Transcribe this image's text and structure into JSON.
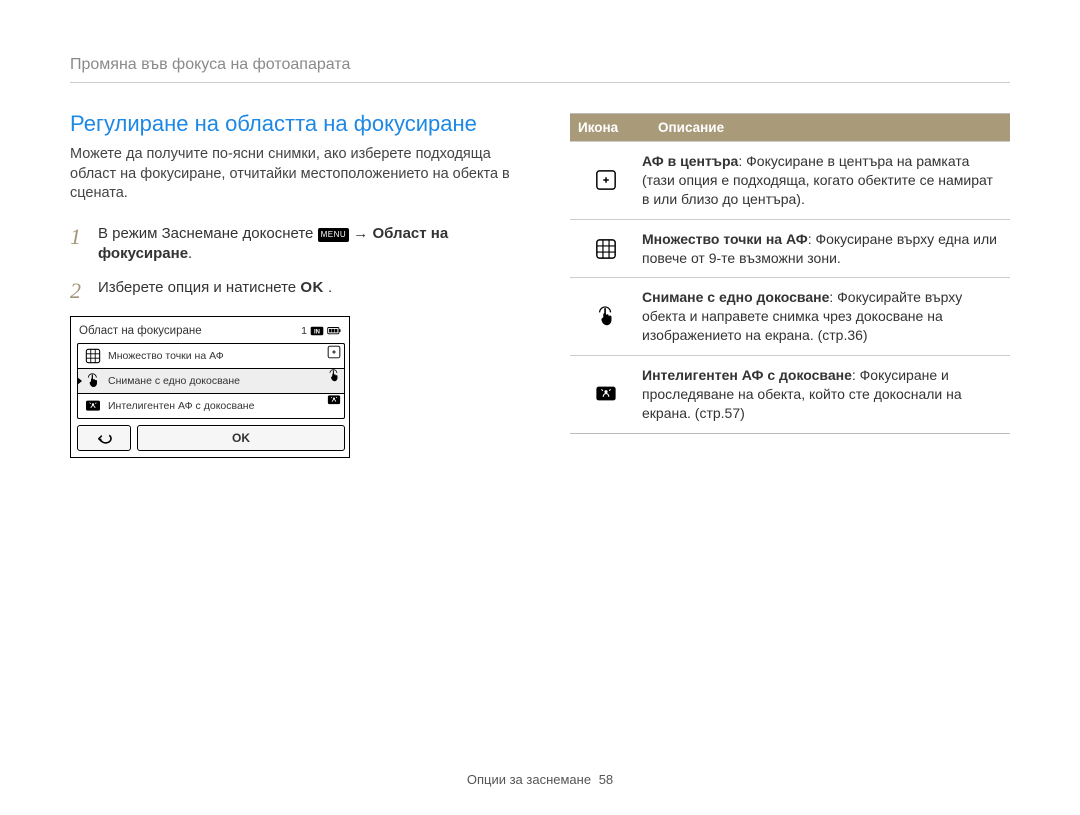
{
  "header": {
    "title": "Промяна във фокуса на фотоапарата"
  },
  "main": {
    "title": "Регулиране на областта на фокусиране",
    "intro": "Можете да получите по-ясни снимки, ако изберете подходяща област на фокусиране, отчитайки местоположението на обекта в сцената.",
    "step1": {
      "prefix": "В режим Заснемане докоснете ",
      "menu_label": "MENU",
      "arrow": " → ",
      "suffix_bold": "Област на фокусиране",
      "tail": "."
    },
    "step2": {
      "prefix": "Изберете опция и натиснете ",
      "ok": "OK",
      "tail": " ."
    }
  },
  "lcd": {
    "title": "Област на фокусиране",
    "status_number": "1",
    "items": [
      {
        "icon": "grid",
        "label": "Множество точки на АФ",
        "selected": false
      },
      {
        "icon": "touch",
        "label": "Снимане с едно докосване",
        "selected": true
      },
      {
        "icon": "track",
        "label": "Интелигентен АФ с докосване",
        "selected": false
      }
    ],
    "side_icons": [
      "center-af",
      "touch",
      "track"
    ],
    "back_label": "↩",
    "ok_label": "OK"
  },
  "table": {
    "headers": {
      "icon": "Икона",
      "desc": "Описание"
    },
    "rows": [
      {
        "icon": "center-af",
        "lead": "АФ в центъра",
        "text": ": Фокусиране в центъра на рамката (тази опция е подходяща, когато обектите се намират в или близо до центъра)."
      },
      {
        "icon": "grid",
        "lead": "Множество точки на АФ",
        "text": ": Фокусиране върху една или повече от 9-те възможни зони."
      },
      {
        "icon": "touch",
        "lead": "Снимане с едно докосване",
        "text": ": Фокусирайте върху обекта и направете снимка чрез докосване на изображението на екрана. (стр.36)"
      },
      {
        "icon": "track",
        "lead": "Интелигентен АФ с докосване",
        "text": ": Фокусиране и проследяване на обекта, който сте докоснали на екрана. (стр.57)"
      }
    ]
  },
  "footer": {
    "section": "Опции за заснемане",
    "page": "58"
  }
}
